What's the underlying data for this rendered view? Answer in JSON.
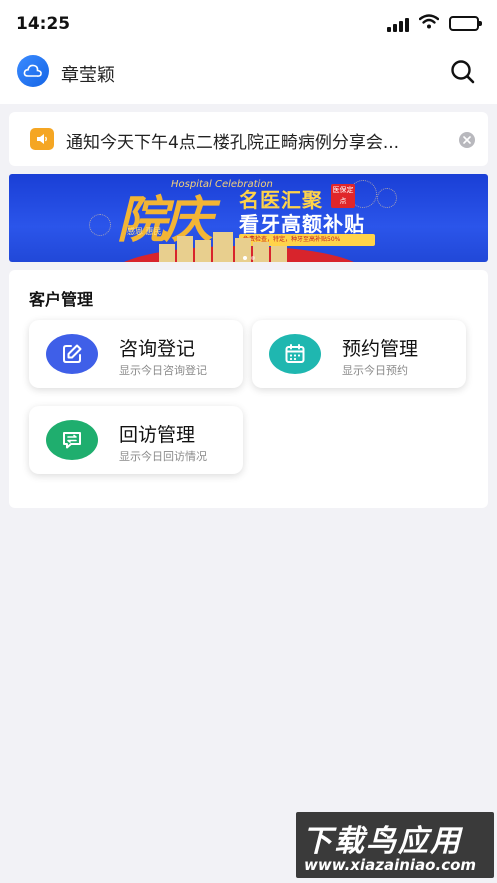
{
  "status_bar": {
    "time": "14:25"
  },
  "header": {
    "username": "章莹颖",
    "search_icon": "search-icon",
    "avatar_icon": "cloud-logo-icon"
  },
  "notice": {
    "text": "通知今天下午4点二楼孔院正畸病例分享会...",
    "icon": "speaker-icon",
    "close_icon": "close-icon"
  },
  "banner": {
    "big_text": "院庆",
    "hospital_en": "Hospital Celebration",
    "subtitle": "感恩 惠民",
    "line1": "名医汇聚",
    "badge": "医保定点",
    "line2": "看牙高额补贴",
    "line3": "免费检查，特定，种牙至高补贴50%",
    "page_indicator": {
      "count": 2,
      "active": 0
    }
  },
  "section": {
    "title": "客户管理",
    "cards": [
      {
        "title": "咨询登记",
        "desc": "显示今日咨询登记",
        "icon": "edit-icon",
        "color": "#3f5fe8"
      },
      {
        "title": "预约管理",
        "desc": "显示今日预约",
        "icon": "calendar-icon",
        "color": "#1fb7b0"
      },
      {
        "title": "回访管理",
        "desc": "显示今日回访情况",
        "icon": "chat-exchange-icon",
        "color": "#1fae6e"
      }
    ]
  },
  "watermark": {
    "cn": "下载鸟应用",
    "url": "www.xiazainiao.com"
  },
  "colors": {
    "background": "#f2f2f6",
    "accent": "#1565e6",
    "notice_icon": "#f5a623"
  }
}
